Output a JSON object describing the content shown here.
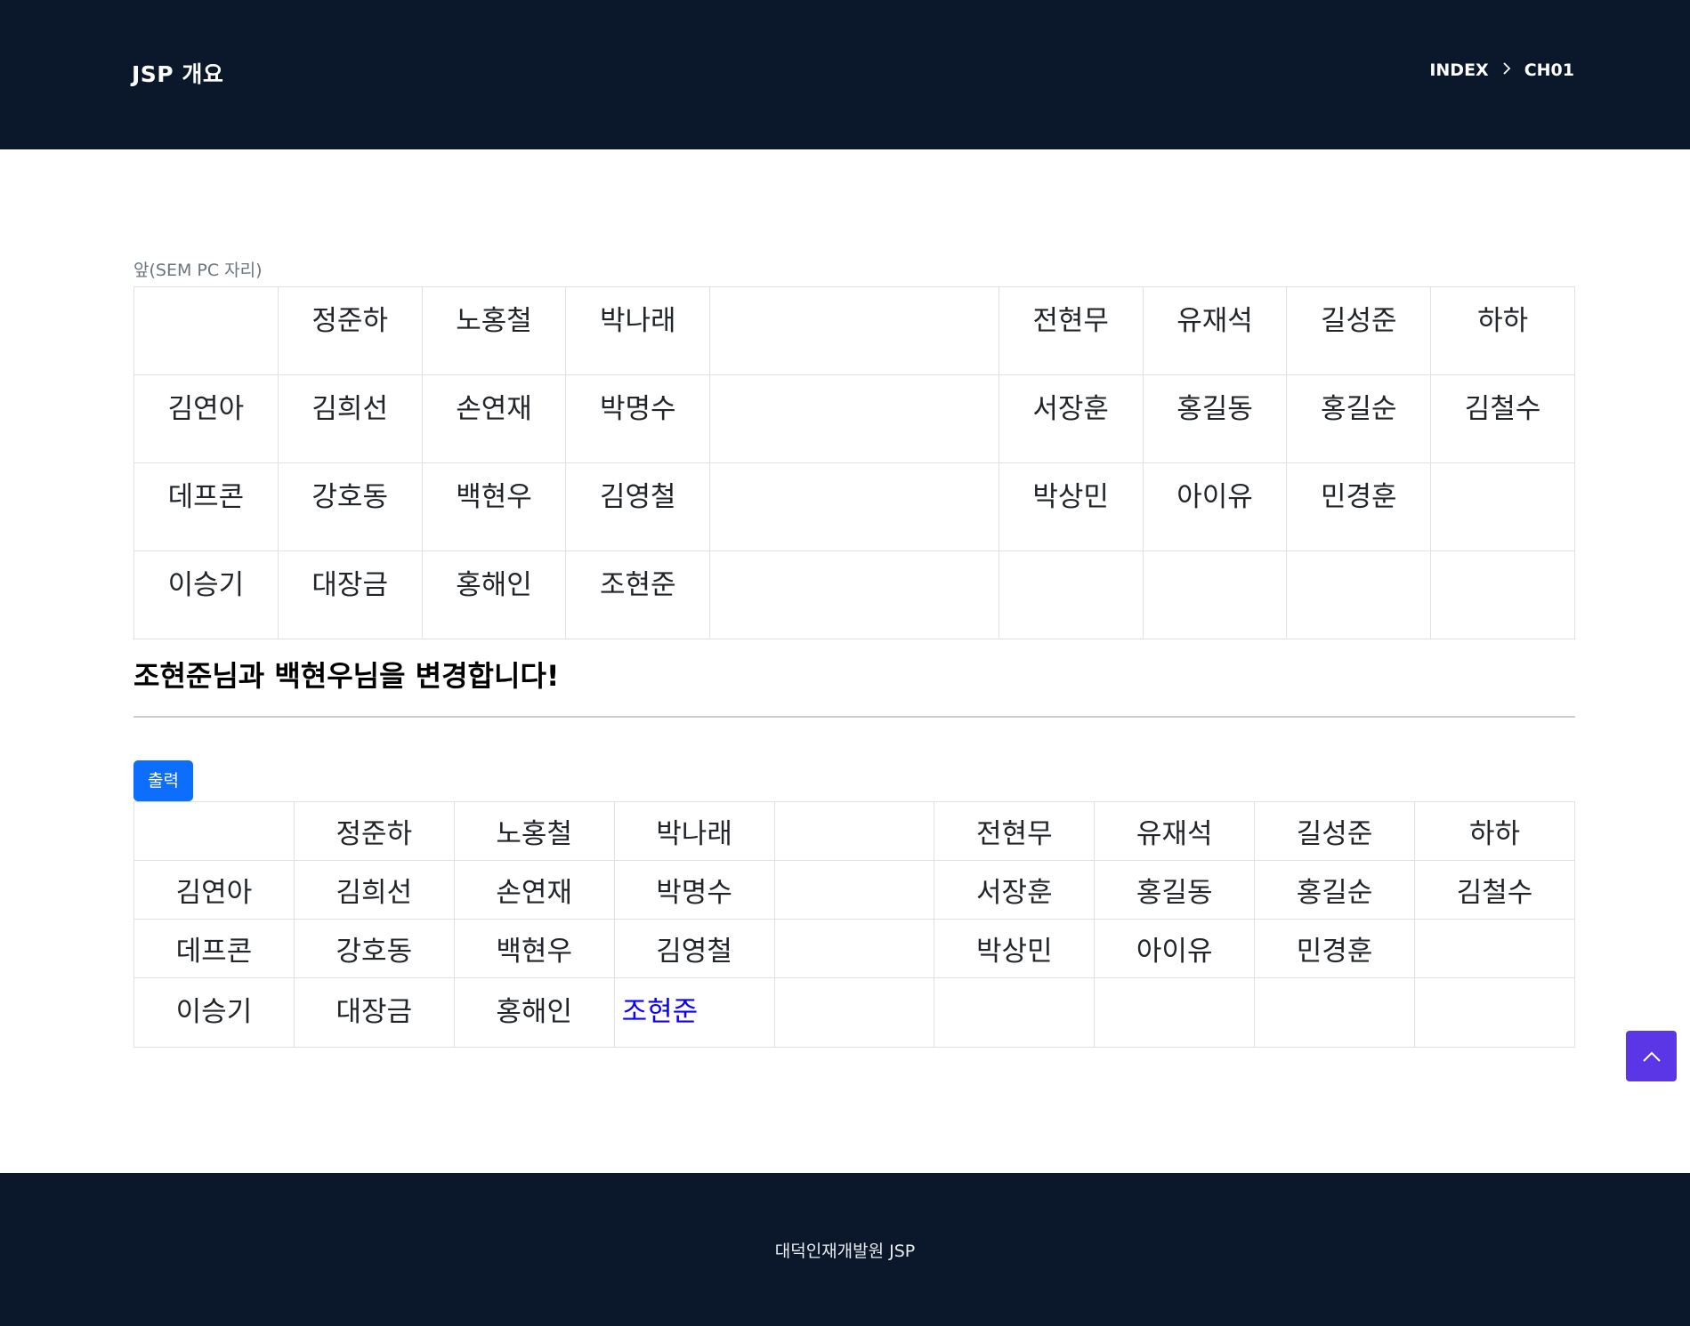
{
  "header": {
    "title": "JSP 개요",
    "breadcrumb": [
      "INDEX",
      "CH01"
    ]
  },
  "seat_front_label": "앞(SEM PC 자리)",
  "seating_before": [
    [
      "",
      "정준하",
      "노홍철",
      "박나래",
      "",
      "전현무",
      "유재석",
      "길성준",
      "하하"
    ],
    [
      "김연아",
      "김희선",
      "손연재",
      "박명수",
      "",
      "서장훈",
      "홍길동",
      "홍길순",
      "김철수"
    ],
    [
      "데프콘",
      "강호동",
      "백현우",
      "김영철",
      "",
      "박상민",
      "아이유",
      "민경훈",
      ""
    ],
    [
      "이승기",
      "대장금",
      "홍해인",
      "조현준",
      "",
      "",
      "",
      "",
      ""
    ]
  ],
  "notice": "조현준님과 백현우님을 변경합니다!",
  "print_button": "출력",
  "seating_after": [
    [
      "",
      "정준하",
      "노홍철",
      "박나래",
      "",
      "전현무",
      "유재석",
      "길성준",
      "하하"
    ],
    [
      "김연아",
      "김희선",
      "손연재",
      "박명수",
      "",
      "서장훈",
      "홍길동",
      "홍길순",
      "김철수"
    ],
    [
      "데프콘",
      "강호동",
      "백현우",
      "김영철",
      "",
      "박상민",
      "아이유",
      "민경훈",
      ""
    ],
    [
      "이승기",
      "대장금",
      "홍해인",
      "조현준",
      "",
      "",
      "",
      "",
      ""
    ]
  ],
  "highlight_color": "#0b00ff",
  "to_top_icon": "chevron-up-icon",
  "footer": {
    "text": "대덕인재개발원 JSP"
  }
}
